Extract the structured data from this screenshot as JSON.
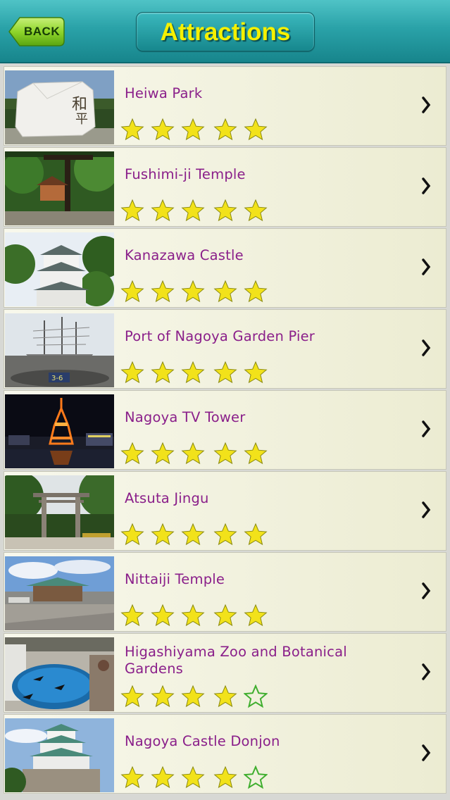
{
  "header": {
    "back_label": "BACK",
    "title": "Attractions"
  },
  "colors": {
    "header_teal": "#2aa2a8",
    "title_yellow": "#f5f000",
    "back_green": "#7ed321",
    "name_purple": "#8a1f8a",
    "star_yellow": "#f2e21a",
    "star_outline": "#3fae2e"
  },
  "attractions": [
    {
      "name": "Heiwa Park",
      "rating": 5,
      "thumb_icon": "stone-monument-photo"
    },
    {
      "name": "Fushimi-ji Temple",
      "rating": 5,
      "thumb_icon": "temple-garden-photo"
    },
    {
      "name": "Kanazawa Castle",
      "rating": 5,
      "thumb_icon": "castle-photo"
    },
    {
      "name": "Port of Nagoya Garden Pier",
      "rating": 5,
      "thumb_icon": "sailing-ship-photo"
    },
    {
      "name": "Nagoya TV Tower",
      "rating": 5,
      "thumb_icon": "tv-tower-night-photo"
    },
    {
      "name": "Atsuta Jingu",
      "rating": 5,
      "thumb_icon": "torii-gate-photo"
    },
    {
      "name": "Nittaiji Temple",
      "rating": 5,
      "thumb_icon": "temple-plaza-photo"
    },
    {
      "name": "Higashiyama Zoo and Botanical Gardens",
      "rating": 4,
      "thumb_icon": "zoo-pool-photo"
    },
    {
      "name": "Nagoya Castle Donjon",
      "rating": 4,
      "thumb_icon": "castle-donjon-photo"
    }
  ],
  "icons": {
    "chevron": "chevron-right-icon",
    "filled_star": "star-filled-icon",
    "empty_star": "star-outline-icon"
  }
}
